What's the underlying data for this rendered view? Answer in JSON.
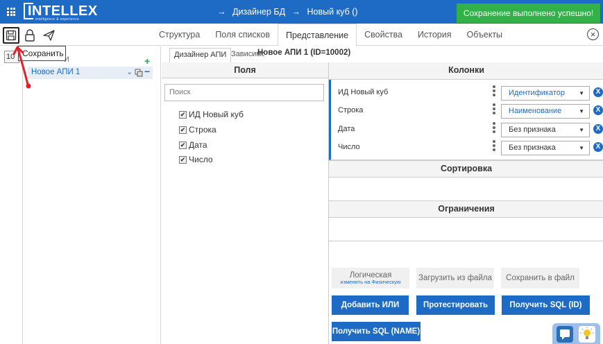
{
  "header": {
    "logo_text": "INTELLEX",
    "logo_sub": "intelligence & experience",
    "breadcrumb": [
      "→",
      "Дизайнер БД",
      "→",
      "Новый куб ()"
    ],
    "success_message": "Сохранение выполнено успешно!"
  },
  "toolbar": {
    "tabs": [
      {
        "label": "Структура"
      },
      {
        "label": "Поля списков"
      },
      {
        "label": "Представление"
      },
      {
        "label": "Свойства"
      },
      {
        "label": "История"
      },
      {
        "label": "Объекты"
      }
    ],
    "active_tab": "Представление",
    "close_symbol": "⊗"
  },
  "tooltip": {
    "text": "Сохранить"
  },
  "left": {
    "stub_text": "10",
    "header_stub": "И",
    "add_symbol": "+",
    "selected_item": "Новое АПИ 1",
    "remove_symbol": "−"
  },
  "middle": {
    "subtab_active": "Дизайнер АПИ",
    "subtab_inactive": "Зависимости",
    "api_title": "Новое АПИ 1 (ID=10002)",
    "fields_heading": "Поля",
    "search_placeholder": "Поиск",
    "fields": [
      {
        "label": "ИД Новый куб",
        "checked": true
      },
      {
        "label": "Строка",
        "checked": true
      },
      {
        "label": "Дата",
        "checked": true
      },
      {
        "label": "Число",
        "checked": true
      }
    ]
  },
  "right": {
    "columns_heading": "Колонки",
    "columns": [
      {
        "name": "ИД Новый куб",
        "value": "Идентификатор",
        "accent": "#1e6bc6"
      },
      {
        "name": "Строка",
        "value": "Наименование",
        "accent": "#1e6bc6"
      },
      {
        "name": "Дата",
        "value": "Без признака",
        "accent": "#333333"
      },
      {
        "name": "Число",
        "value": "Без признака",
        "accent": "#333333"
      }
    ],
    "remove_symbol": "X",
    "sort_heading": "Сортировка",
    "limits_heading": "Ограничения"
  },
  "actions": {
    "logical_label": "Логическая",
    "logical_sub": "изменить на Физическую",
    "load_file": "Загрузить из файла",
    "save_file": "Сохранить в файл",
    "add_or": "Добавить ИЛИ",
    "test": "Протестировать",
    "get_sql_id": "Получить SQL (ID)",
    "get_sql_name": "Получить SQL (NAME)"
  },
  "colors": {
    "brand_blue": "#1e6bc6",
    "success_green": "#33b149",
    "annotation_red": "#e31e24"
  }
}
